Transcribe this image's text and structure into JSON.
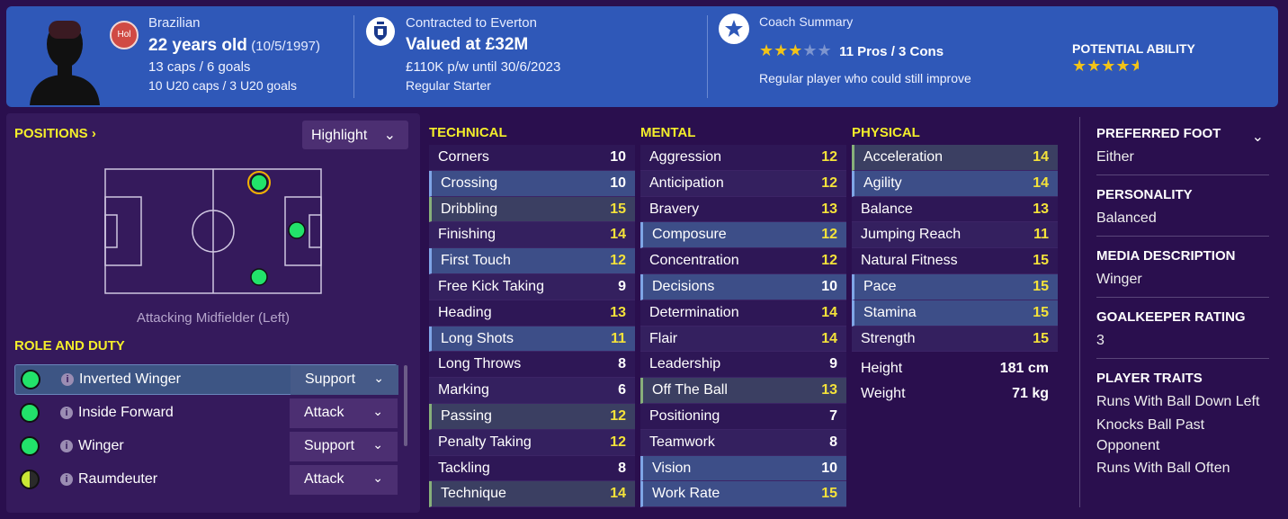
{
  "header": {
    "nationality": "Brazilian",
    "nation_code": "Hol",
    "age": "22 years old",
    "dob": "(10/5/1997)",
    "caps": "13 caps / 6 goals",
    "u20_caps": "10 U20 caps / 3 U20 goals",
    "contract": "Contracted to Everton",
    "value": "Valued at £32M",
    "wage": "£110K p/w until 30/6/2023",
    "squad_status": "Regular Starter",
    "coach_title": "Coach Summary",
    "coach_stars": 3,
    "coach_stars_max": 5,
    "pros_cons": "11 Pros / 3 Cons",
    "coach_note": "Regular player who could still improve",
    "potential_label": "POTENTIAL ABILITY",
    "potential_stars": 4.5,
    "colors": {
      "header_bg": "#2f58b8",
      "page_bg": "#2a0f4e",
      "star_on": "#f2c318",
      "accent_yellow": "#f4ee2a"
    }
  },
  "positions": {
    "title": "POSITIONS",
    "dropdown": "Highlight",
    "caption": "Attacking Midfielder (Left)"
  },
  "roles": {
    "title": "ROLE AND DUTY",
    "items": [
      {
        "name": "Inverted Winger",
        "duty": "Support",
        "selected": true,
        "suitability": "full"
      },
      {
        "name": "Inside Forward",
        "duty": "Attack",
        "selected": false,
        "suitability": "full"
      },
      {
        "name": "Winger",
        "duty": "Support",
        "selected": false,
        "suitability": "full"
      },
      {
        "name": "Raumdeuter",
        "duty": "Attack",
        "selected": false,
        "suitability": "half"
      }
    ]
  },
  "technical": {
    "title": "TECHNICAL",
    "items": [
      {
        "name": "Corners",
        "value": "10",
        "style": ""
      },
      {
        "name": "Crossing",
        "value": "10",
        "style": "hl-blue"
      },
      {
        "name": "Dribbling",
        "value": "15",
        "style": "hl-green"
      },
      {
        "name": "Finishing",
        "value": "14",
        "style": ""
      },
      {
        "name": "First Touch",
        "value": "12",
        "style": "hl-blue"
      },
      {
        "name": "Free Kick Taking",
        "value": "9",
        "style": ""
      },
      {
        "name": "Heading",
        "value": "13",
        "style": ""
      },
      {
        "name": "Long Shots",
        "value": "11",
        "style": "hl-blue"
      },
      {
        "name": "Long Throws",
        "value": "8",
        "style": ""
      },
      {
        "name": "Marking",
        "value": "6",
        "style": ""
      },
      {
        "name": "Passing",
        "value": "12",
        "style": "hl-green"
      },
      {
        "name": "Penalty Taking",
        "value": "12",
        "style": ""
      },
      {
        "name": "Tackling",
        "value": "8",
        "style": ""
      },
      {
        "name": "Technique",
        "value": "14",
        "style": "hl-green"
      }
    ]
  },
  "mental": {
    "title": "MENTAL",
    "items": [
      {
        "name": "Aggression",
        "value": "12",
        "style": ""
      },
      {
        "name": "Anticipation",
        "value": "12",
        "style": ""
      },
      {
        "name": "Bravery",
        "value": "13",
        "style": ""
      },
      {
        "name": "Composure",
        "value": "12",
        "style": "hl-blue"
      },
      {
        "name": "Concentration",
        "value": "12",
        "style": ""
      },
      {
        "name": "Decisions",
        "value": "10",
        "style": "hl-blue"
      },
      {
        "name": "Determination",
        "value": "14",
        "style": ""
      },
      {
        "name": "Flair",
        "value": "14",
        "style": ""
      },
      {
        "name": "Leadership",
        "value": "9",
        "style": ""
      },
      {
        "name": "Off The Ball",
        "value": "13",
        "style": "hl-green"
      },
      {
        "name": "Positioning",
        "value": "7",
        "style": ""
      },
      {
        "name": "Teamwork",
        "value": "8",
        "style": ""
      },
      {
        "name": "Vision",
        "value": "10",
        "style": "hl-blue"
      },
      {
        "name": "Work Rate",
        "value": "15",
        "style": "hl-blue"
      }
    ]
  },
  "physical": {
    "title": "PHYSICAL",
    "items": [
      {
        "name": "Acceleration",
        "value": "14",
        "style": "hl-green"
      },
      {
        "name": "Agility",
        "value": "14",
        "style": "hl-blue"
      },
      {
        "name": "Balance",
        "value": "13",
        "style": ""
      },
      {
        "name": "Jumping Reach",
        "value": "11",
        "style": ""
      },
      {
        "name": "Natural Fitness",
        "value": "15",
        "style": ""
      },
      {
        "name": "Pace",
        "value": "15",
        "style": "hl-blue"
      },
      {
        "name": "Stamina",
        "value": "15",
        "style": "hl-blue"
      },
      {
        "name": "Strength",
        "value": "15",
        "style": ""
      }
    ],
    "height_label": "Height",
    "height_value": "181 cm",
    "weight_label": "Weight",
    "weight_value": "71 kg"
  },
  "info": {
    "preferred_foot_title": "PREFERRED FOOT",
    "preferred_foot": "Either",
    "personality_title": "PERSONALITY",
    "personality": "Balanced",
    "media_title": "MEDIA DESCRIPTION",
    "media": "Winger",
    "gk_title": "GOALKEEPER RATING",
    "gk": "3",
    "traits_title": "PLAYER TRAITS",
    "traits": [
      "Runs With Ball Down Left",
      "Knocks Ball Past Opponent",
      "Runs With Ball Often"
    ]
  }
}
